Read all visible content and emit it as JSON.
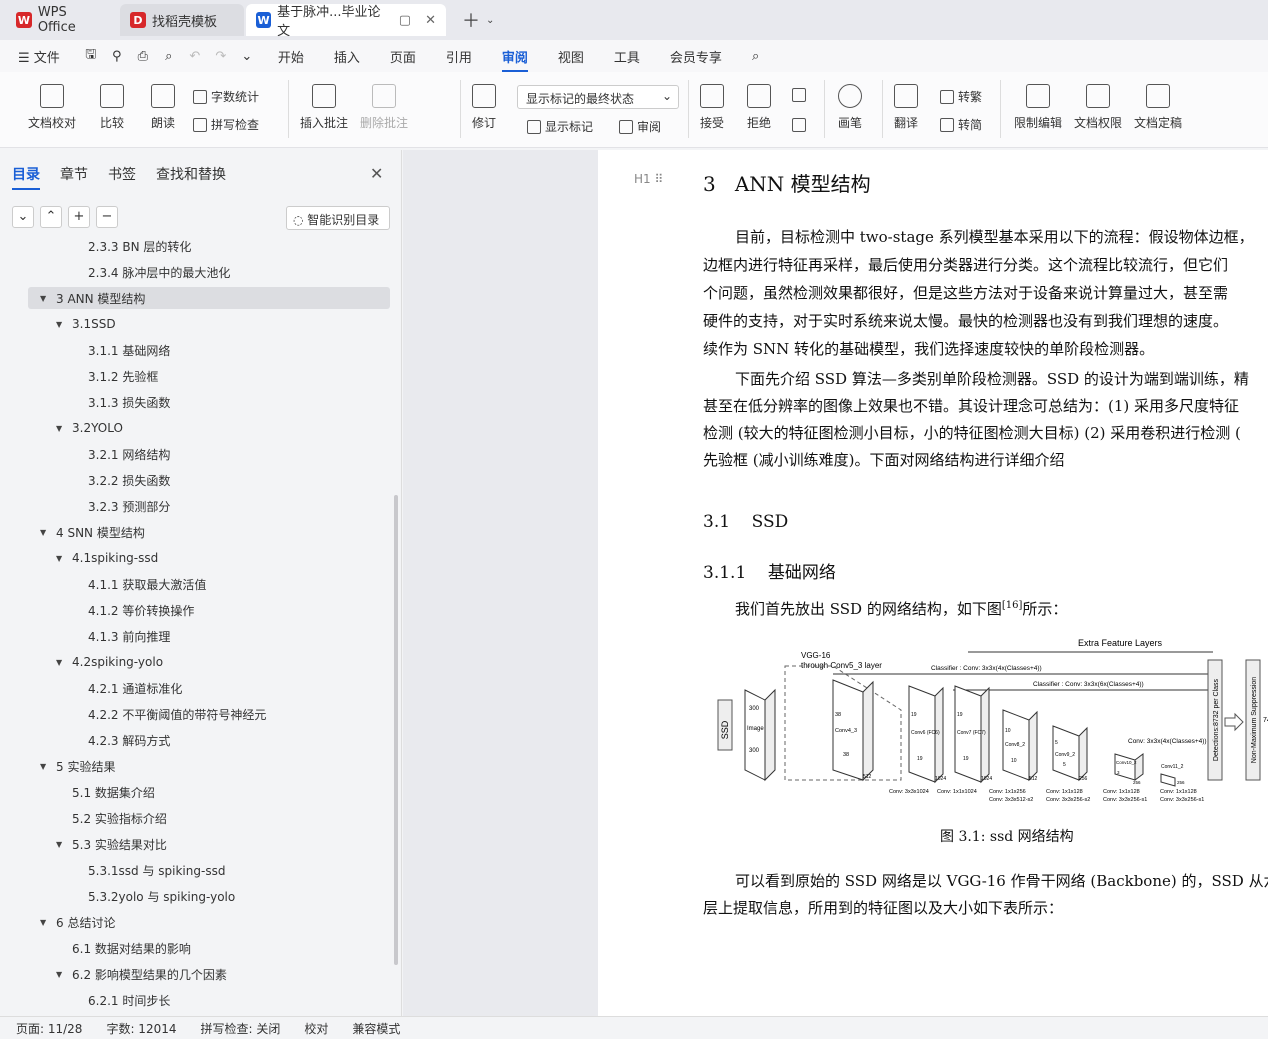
{
  "tabs": [
    {
      "label": "WPS Office",
      "color": "#d7282a"
    },
    {
      "label": "找稻壳模板",
      "color": "#d7282a"
    },
    {
      "label": "基于脉冲...毕业论文",
      "color": "#1a5fd6"
    }
  ],
  "menu": {
    "file": "文件",
    "items": [
      "开始",
      "插入",
      "页面",
      "引用",
      "审阅",
      "视图",
      "工具",
      "会员专享"
    ],
    "selected": "审阅"
  },
  "ribbon": {
    "doc_check": "文档校对",
    "compare": "比较",
    "read_aloud": "朗读",
    "word_count": "字数统计",
    "spell_check": "拼写检查",
    "insert_comment": "插入批注",
    "delete_comment": "删除批注",
    "revise": "修订",
    "display_mode": "显示标记的最终状态",
    "show_markup": "显示标记",
    "review": "审阅",
    "accept": "接受",
    "reject": "拒绝",
    "pen": "画笔",
    "translate": "翻译",
    "to_traditional": "转繁",
    "to_simplified": "转简",
    "restrict_edit": "限制编辑",
    "doc_permission": "文档权限",
    "finalize": "文档定稿"
  },
  "sidebar": {
    "tabs": [
      "目录",
      "章节",
      "书签",
      "查找和替换"
    ],
    "smart_toc": "智能识别目录",
    "toc": [
      {
        "label": "2.3.3  BN 层的转化",
        "level": 3,
        "arrow": ""
      },
      {
        "label": "2.3.4  脉冲层中的最大池化",
        "level": 3,
        "arrow": ""
      },
      {
        "label": "3  ANN 模型结构",
        "level": 1,
        "arrow": "▼",
        "selected": true
      },
      {
        "label": "3.1SSD",
        "level": 2,
        "arrow": "▼"
      },
      {
        "label": "3.1.1  基础网络",
        "level": 3,
        "arrow": ""
      },
      {
        "label": "3.1.2  先验框",
        "level": 3,
        "arrow": ""
      },
      {
        "label": "3.1.3  损失函数",
        "level": 3,
        "arrow": ""
      },
      {
        "label": "3.2YOLO",
        "level": 2,
        "arrow": "▼"
      },
      {
        "label": "3.2.1  网络结构",
        "level": 3,
        "arrow": ""
      },
      {
        "label": "3.2.2  损失函数",
        "level": 3,
        "arrow": ""
      },
      {
        "label": "3.2.3    预测部分",
        "level": 3,
        "arrow": ""
      },
      {
        "label": "4  SNN 模型结构",
        "level": 1,
        "arrow": "▼"
      },
      {
        "label": "4.1spiking-ssd",
        "level": 2,
        "arrow": "▼"
      },
      {
        "label": "4.1.1  获取最大激活值",
        "level": 3,
        "arrow": ""
      },
      {
        "label": "4.1.2  等价转换操作",
        "level": 3,
        "arrow": ""
      },
      {
        "label": "4.1.3  前向推理",
        "level": 3,
        "arrow": ""
      },
      {
        "label": "4.2spiking-yolo",
        "level": 2,
        "arrow": "▼"
      },
      {
        "label": "4.2.1  通道标准化",
        "level": 3,
        "arrow": ""
      },
      {
        "label": "4.2.2  不平衡阈值的带符号神经元",
        "level": 3,
        "arrow": ""
      },
      {
        "label": "4.2.3  解码方式",
        "level": 3,
        "arrow": ""
      },
      {
        "label": "5  实验结果",
        "level": 1,
        "arrow": "▼"
      },
      {
        "label": "5.1  数据集介绍",
        "level": 2,
        "arrow": ""
      },
      {
        "label": "5.2  实验指标介绍",
        "level": 2,
        "arrow": ""
      },
      {
        "label": "5.3  实验结果对比",
        "level": 2,
        "arrow": "▼"
      },
      {
        "label": "5.3.1ssd 与 spiking-ssd",
        "level": 3,
        "arrow": ""
      },
      {
        "label": "5.3.2yolo 与 spiking-yolo",
        "level": 3,
        "arrow": ""
      },
      {
        "label": "6  总结讨论",
        "level": 1,
        "arrow": "▼"
      },
      {
        "label": "6.1  数据对结果的影响",
        "level": 2,
        "arrow": ""
      },
      {
        "label": "6.2  影响模型结果的几个因素",
        "level": 2,
        "arrow": "▼"
      },
      {
        "label": "6.2.1  时间步长",
        "level": 3,
        "arrow": ""
      }
    ]
  },
  "document": {
    "heading_marker": "H1",
    "h1_num": "3",
    "h1_text": "ANN 模型结构",
    "para1": [
      "目前，目标检测中 two-stage 系列模型基本采用以下的流程：假设物体边框，",
      "边框内进行特征再采样，最后使用分类器进行分类。这个流程比较流行，但它们",
      "个问题，虽然检测效果都很好，但是这些方法对于设备来说计算量过大，甚至需",
      "硬件的支持，对于实时系统来说太慢。最快的检测器也没有到我们理想的速度。",
      "续作为 SNN 转化的基础模型，我们选择速度较快的单阶段检测器。"
    ],
    "para2": [
      "下面先介绍  SSD 算法—多类别单阶段检测器。SSD 的设计为端到端训练，精",
      "甚至在低分辨率的图像上效果也不错。其设计理念可总结为：(1) 采用多尺度特征",
      "检测 (较大的特征图检测小目标，小的特征图检测大目标) (2) 采用卷积进行检测 (",
      "先验框 (减小训练难度)。下面对网络结构进行详细介绍"
    ],
    "h2_num": "3.1",
    "h2_text": "SSD",
    "h3_num": "3.1.1",
    "h3_text": "基础网络",
    "para3": "我们首先放出  SSD 的网络结构，如下图",
    "para3_ref": "[16]",
    "para3_end": "所示：",
    "figure": {
      "extra": "Extra Feature Layers",
      "vgg": "VGG-16",
      "vgg2": "through Conv5_3 layer",
      "cls1": "Classifier : Conv: 3x3x(4x(Classes+4))",
      "cls2": "Classifier : Conv: 3x3x(6x(Classes+4))",
      "cls3": "Conv: 3x3x(4x(Classes+4))",
      "ssd": "SSD",
      "det": "Detections:8732 per Class",
      "nms": "Non-Maximum Suppression",
      "image": "Image",
      "n300a": "300",
      "n300b": "300",
      "conv43": "Conv4_3",
      "n38a": "38",
      "n38b": "38",
      "n512": "512",
      "conv6": "Conv6 (FC6)",
      "n19a": "19",
      "n19b": "19",
      "n1024a": "1024",
      "conv7": "Conv7 (FC7)",
      "n19c": "19",
      "n19d": "19",
      "n1024b": "1024",
      "conv82": "Conv8_2",
      "n10a": "10",
      "n10b": "10",
      "n512b": "512",
      "conv92": "Conv9_2",
      "n5a": "5",
      "n5b": "5",
      "n256a": "256",
      "conv102": "Conv10_2",
      "n3a": "3",
      "n256b": "256",
      "conv112": "Conv11_2",
      "n256c": "256",
      "bl1": "Conv: 3x3x1024",
      "bl2": "Conv: 1x1x1024",
      "bl3": "Conv: 1x1x256",
      "bl3b": "Conv: 3x3x512-s2",
      "bl4": "Conv: 1x1x128",
      "bl4b": "Conv: 3x3x256-s2",
      "bl5": "Conv: 1x1x128",
      "bl5b": "Conv: 3x3x256-s1",
      "bl6": "Conv: 1x1x128",
      "bl6b": "Conv: 3x3x256-s1",
      "n74": "74",
      "caption": "图 3.1: ssd 网络结构"
    },
    "para4": [
      "可以看到原始的 SSD 网络是以 VGG-16 作骨干网络 (Backbone) 的，SSD 从六",
      "层上提取信息，所用到的特征图以及大小如下表所示："
    ]
  },
  "status": {
    "page": "页面: 11/28",
    "words": "字数: 12014",
    "spell": "拼写检查: 关闭",
    "proof": "校对",
    "compat": "兼容模式"
  },
  "colors": {
    "accent": "#1a5fd6",
    "wps_red": "#d7282a"
  }
}
